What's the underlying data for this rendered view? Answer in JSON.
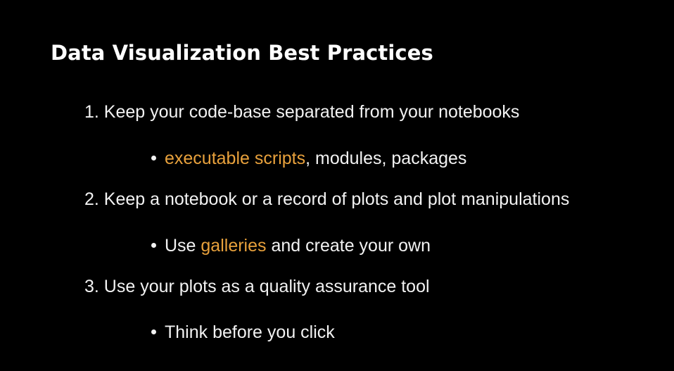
{
  "slide": {
    "title": "Data Visualization Best Practices",
    "accent_color": "#e8a13c",
    "points": [
      {
        "text": "1. Keep your code-base separated from your notebooks",
        "sub": {
          "highlight": "executable scripts",
          "rest": ", modules, packages"
        }
      },
      {
        "text": "2. Keep a notebook or a record of plots and plot manipulations",
        "sub": {
          "before": "Use ",
          "highlight": "galleries",
          "rest": " and create your own"
        }
      },
      {
        "text": "3. Use your plots as a quality assurance tool",
        "sub": {
          "text": "Think before you click"
        }
      }
    ]
  }
}
